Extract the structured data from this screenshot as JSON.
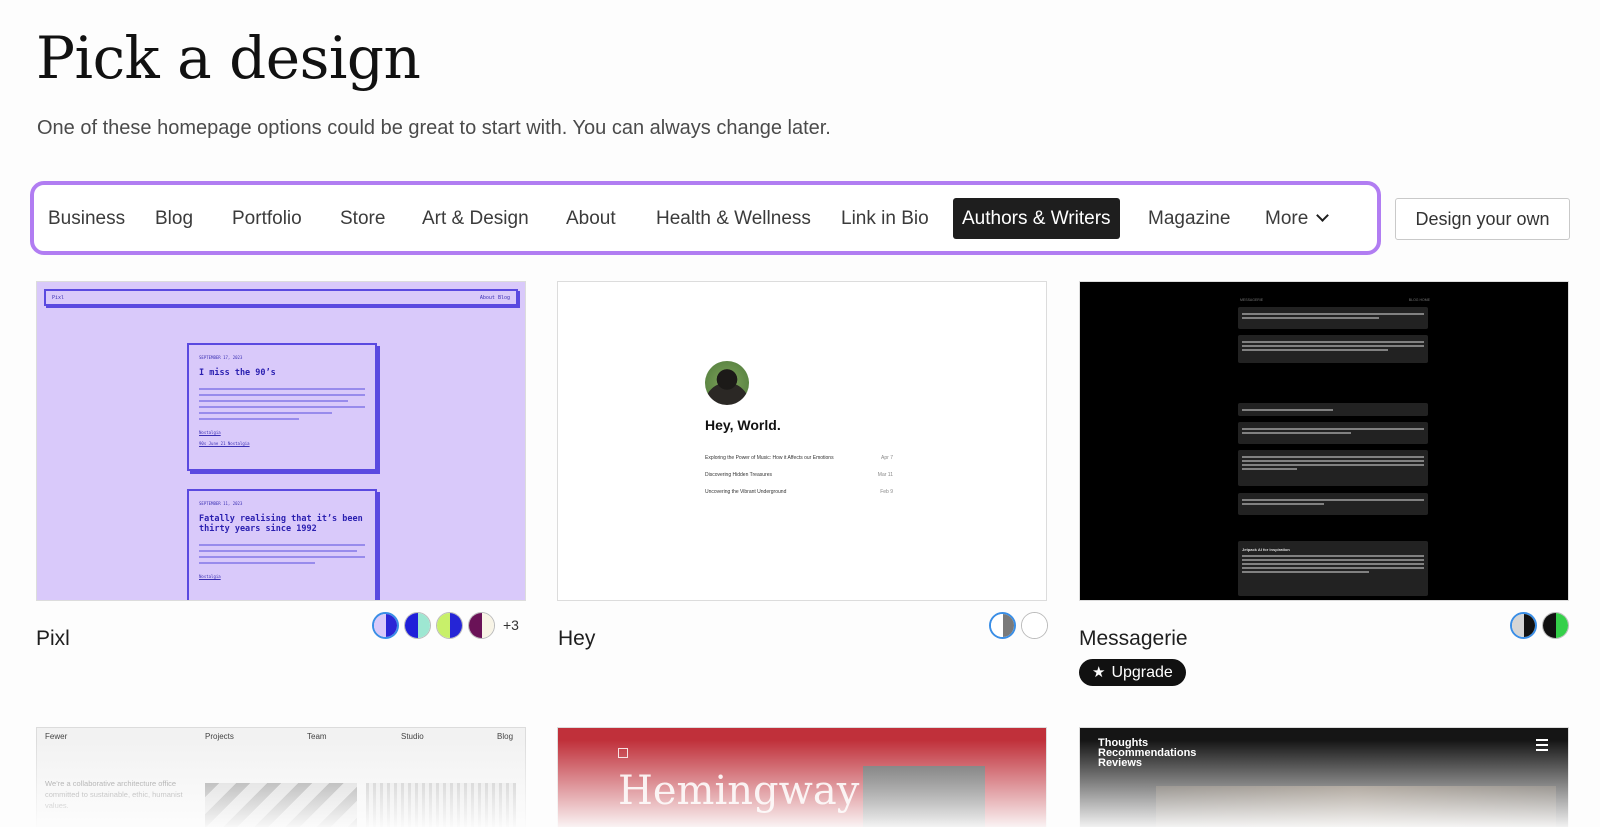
{
  "page": {
    "title": "Pick a design",
    "subtitle": "One of these homepage options could be great to start with. You can always change later."
  },
  "categories": {
    "items": [
      "Business",
      "Blog",
      "Portfolio",
      "Store",
      "Art & Design",
      "About",
      "Health & Wellness",
      "Link in Bio",
      "Authors & Writers",
      "Magazine",
      "More"
    ],
    "active": "Authors & Writers"
  },
  "design_your_own_label": "Design your own",
  "themes": [
    {
      "name": "Pixl",
      "more_styles": "+3",
      "preview": {
        "nav_left": "Pixl",
        "nav_right": "About  Blog",
        "posts": [
          {
            "date": "SEPTEMBER 17, 2023",
            "title": "I miss the 90’s",
            "more": "Nostalgia",
            "meta": "90s  June 21  Nostalgia"
          },
          {
            "date": "SEPTEMBER 11, 2023",
            "title": "Fatally realising that it’s been thirty years since 1992",
            "more": "Nostalgia"
          }
        ]
      },
      "colors": {
        "bg": "#d9c9fa",
        "accent": "#5a49e0"
      }
    },
    {
      "name": "Hey",
      "preview": {
        "heading": "Hey, World.",
        "posts": [
          {
            "title": "Exploring the Power of Music: How it Affects our Emotions",
            "date": "Apr 7"
          },
          {
            "title": "Discovering Hidden Treasures",
            "date": "Mar 11"
          },
          {
            "title": "Uncovering the Vibrant Underground",
            "date": "Feb 9"
          }
        ]
      }
    },
    {
      "name": "Messagerie",
      "badge": "Upgrade",
      "preview": {
        "top_left": "MESSAGERIE",
        "top_right": "BLOG   HOME",
        "highlight_title": "Jetpack AI for inspiration"
      }
    }
  ],
  "bottom_previews": {
    "fewer": {
      "nav": [
        "Fewer",
        "Projects",
        "Team",
        "Studio",
        "Blog"
      ],
      "text": "We’re a collaborative architecture office committed to sustainable, ethic, humanist values."
    },
    "hemingway": {
      "title": "Hemingway"
    },
    "thoughts": {
      "menu_lines": [
        "Thoughts",
        "Recommendations",
        "Reviews"
      ]
    }
  },
  "colors": {
    "filter_outline": "#b17df2",
    "active_tab_bg": "#1e1e1e",
    "selected_swatch_ring": "#3a8ee6"
  }
}
